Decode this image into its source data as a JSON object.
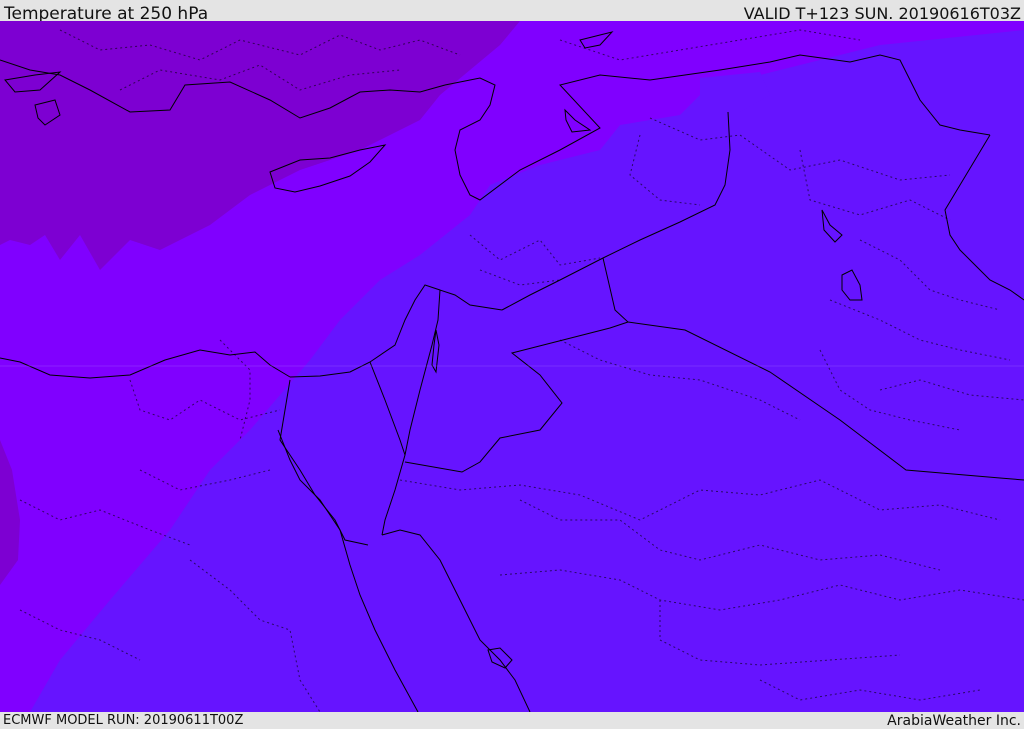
{
  "header": {
    "title": "Temperature at 250 hPa",
    "valid_time": "VALID T+123 SUN. 20190616T03Z"
  },
  "footer": {
    "model_run": "ECMWF MODEL RUN: 20190611T00Z",
    "credit": "ArabiaWeather Inc."
  },
  "map": {
    "colors": {
      "band_coldest": "#7d00d2",
      "band_cold": "#8000ff",
      "band_warm": "#6614ff",
      "border": "#000000"
    }
  }
}
